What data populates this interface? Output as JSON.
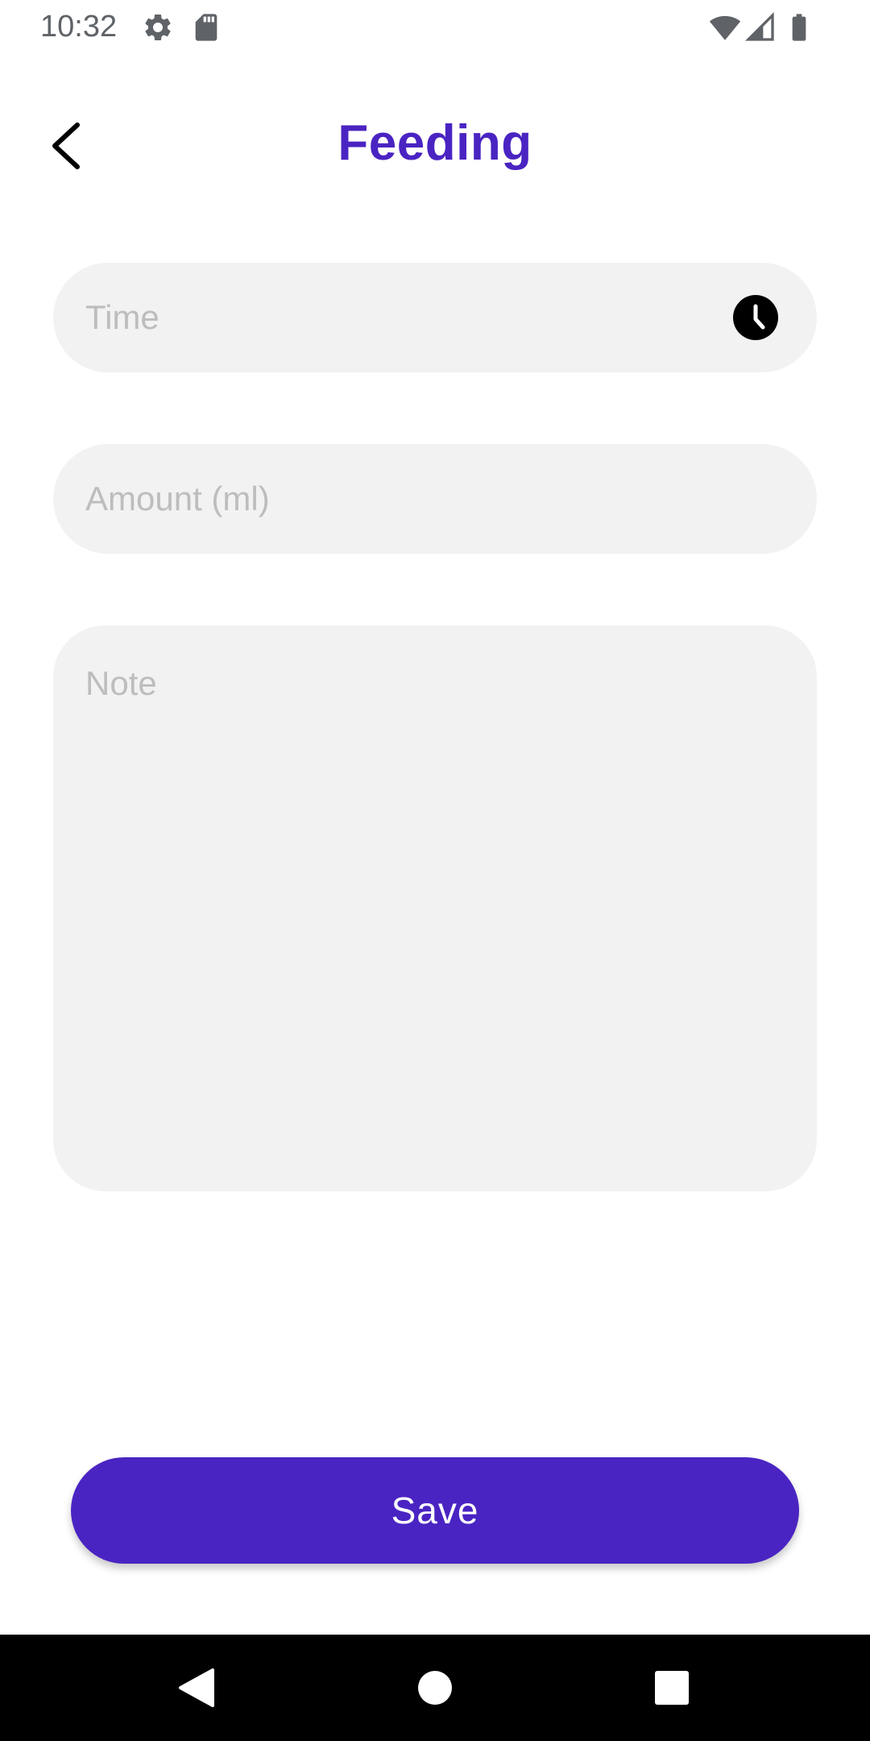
{
  "status_bar": {
    "time": "10:32",
    "icons": [
      "gear-icon",
      "sd-card-icon",
      "wifi-icon",
      "signal-icon",
      "battery-icon"
    ]
  },
  "header": {
    "title": "Feeding",
    "back_icon": "chevron-left-icon"
  },
  "form": {
    "time_placeholder": "Time",
    "time_icon": "clock-icon",
    "amount_placeholder": "Amount (ml)",
    "note_placeholder": "Note"
  },
  "actions": {
    "save_label": "Save"
  },
  "nav_bar": {
    "buttons": [
      "back-triangle-icon",
      "home-circle-icon",
      "recents-square-icon"
    ]
  },
  "colors": {
    "accent": "#4a24c2",
    "field_background": "#f2f2f2",
    "placeholder": "#bdbdbd",
    "status_text": "#5f6368"
  }
}
